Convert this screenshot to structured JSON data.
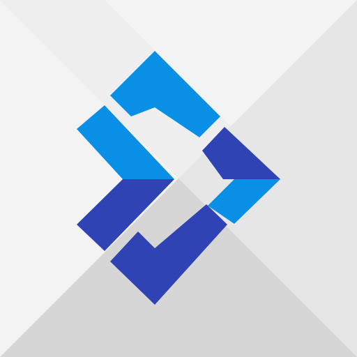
{
  "icon": {
    "name": "blue-arrow-diamond-logo",
    "colors": {
      "background_light": "#f3f3f3",
      "background_mid": "#e6e6e6",
      "background_dark": "#d6d6d6",
      "light_blue": "#0a8fe6",
      "dark_blue": "#2f43b4"
    }
  }
}
